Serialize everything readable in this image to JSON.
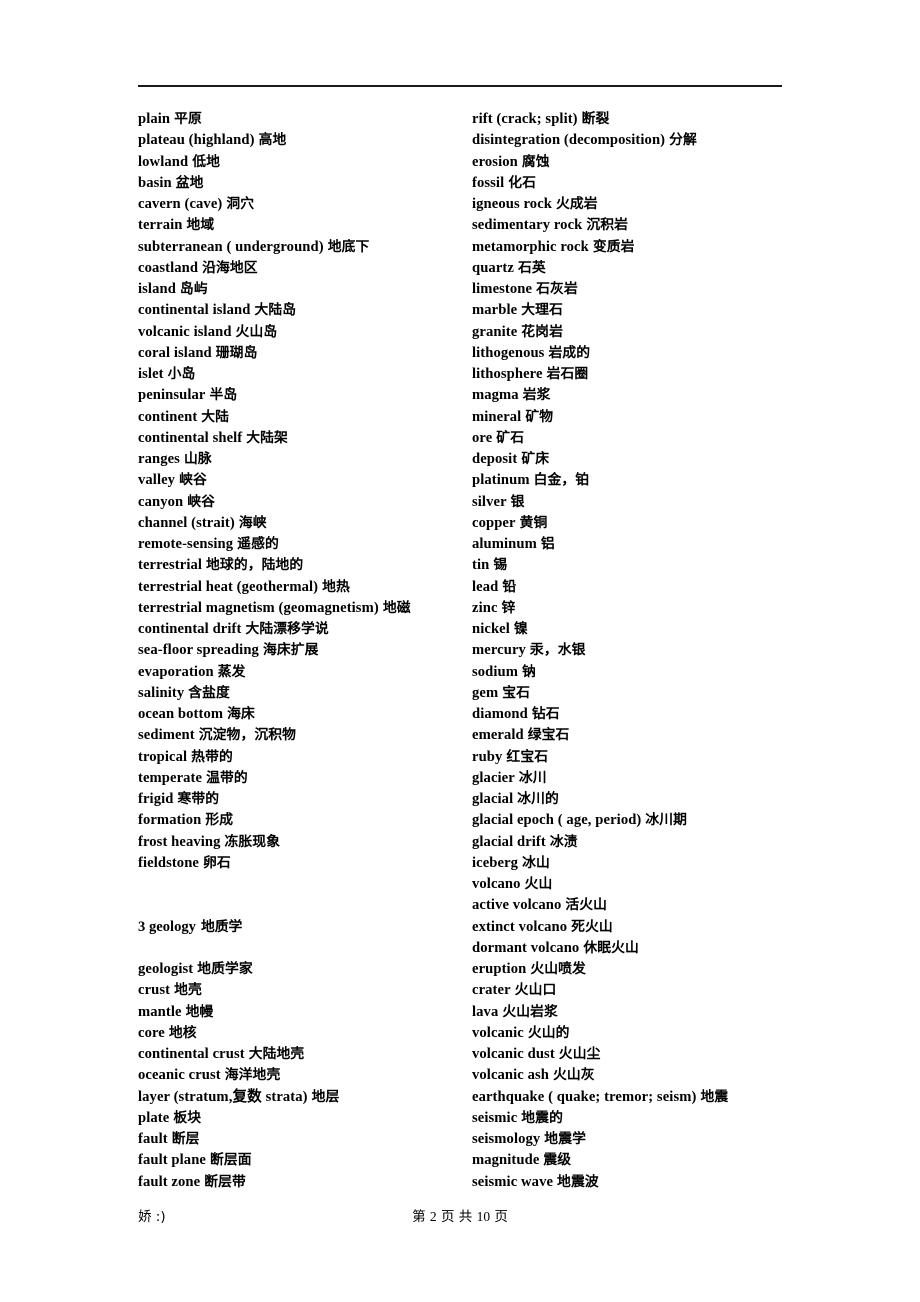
{
  "document": {
    "header_rule": true
  },
  "left_column": {
    "blocks": [
      {
        "type": "list",
        "entries": [
          {
            "term": "plain",
            "gloss": "平原"
          },
          {
            "term": "plateau (highland)",
            "gloss": "高地"
          },
          {
            "term": "lowland",
            "gloss": "低地"
          },
          {
            "term": "basin",
            "gloss": "盆地"
          },
          {
            "term": "cavern (cave)",
            "gloss": "洞穴"
          },
          {
            "term": "terrain",
            "gloss": "地域"
          },
          {
            "term": "subterranean ( underground)",
            "gloss": "地底下"
          },
          {
            "term": "coastland",
            "gloss": "沿海地区"
          },
          {
            "term": "island",
            "gloss": "岛屿"
          },
          {
            "term": "continental island",
            "gloss": "大陆岛"
          },
          {
            "term": "volcanic island",
            "gloss": "火山岛"
          },
          {
            "term": "coral island",
            "gloss": "珊瑚岛"
          },
          {
            "term": "islet",
            "gloss": "小岛"
          },
          {
            "term": "peninsular",
            "gloss": "半岛"
          },
          {
            "term": "continent",
            "gloss": "大陆"
          },
          {
            "term": "continental shelf",
            "gloss": "大陆架"
          },
          {
            "term": "ranges",
            "gloss": "山脉"
          },
          {
            "term": "valley",
            "gloss": "峡谷"
          },
          {
            "term": "canyon",
            "gloss": "峡谷"
          },
          {
            "term": "channel (strait)",
            "gloss": "海峡"
          },
          {
            "term": "remote-sensing",
            "gloss": "遥感的"
          },
          {
            "term": "terrestrial",
            "gloss": "地球的，陆地的"
          },
          {
            "term": "terrestrial heat (geothermal)",
            "gloss": "地热"
          },
          {
            "term": "terrestrial magnetism (geomagnetism)",
            "gloss": "地磁"
          },
          {
            "term": "continental drift",
            "gloss": "大陆漂移学说"
          },
          {
            "term": "sea-floor spreading",
            "gloss": "海床扩展"
          },
          {
            "term": "evaporation",
            "gloss": "蒸发"
          },
          {
            "term": "salinity",
            "gloss": "含盐度"
          },
          {
            "term": "ocean bottom",
            "gloss": "海床"
          },
          {
            "term": "sediment",
            "gloss": "沉淀物，沉积物"
          },
          {
            "term": "tropical",
            "gloss": "热带的"
          },
          {
            "term": "temperate",
            "gloss": "温带的"
          },
          {
            "term": "frigid",
            "gloss": "寒带的"
          },
          {
            "term": "formation",
            "gloss": "形成"
          },
          {
            "term": "frost heaving",
            "gloss": "冻胀现象"
          },
          {
            "term": "fieldstone",
            "gloss": "卵石"
          }
        ]
      },
      {
        "type": "heading",
        "term": "3 geology",
        "gloss": "地质学"
      },
      {
        "type": "list",
        "entries": [
          {
            "term": "geologist",
            "gloss": "地质学家"
          },
          {
            "term": "crust",
            "gloss": "地壳"
          },
          {
            "term": "mantle",
            "gloss": "地幔"
          },
          {
            "term": "core",
            "gloss": "地核"
          },
          {
            "term": "continental crust",
            "gloss": "大陆地壳"
          },
          {
            "term": "oceanic crust",
            "gloss": "海洋地壳"
          },
          {
            "term": "layer (stratum,复数 strata)",
            "gloss": "地层"
          },
          {
            "term": "plate",
            "gloss": "板块"
          },
          {
            "term": "fault",
            "gloss": "断层"
          },
          {
            "term": "fault plane",
            "gloss": "断层面"
          },
          {
            "term": "fault zone",
            "gloss": "断层带"
          }
        ]
      }
    ]
  },
  "right_column": {
    "blocks": [
      {
        "type": "list",
        "entries": [
          {
            "term": "rift (crack; split)",
            "gloss": "断裂"
          },
          {
            "term": "disintegration (decomposition)",
            "gloss": "分解"
          },
          {
            "term": "erosion",
            "gloss": "腐蚀"
          },
          {
            "term": "fossil",
            "gloss": "化石"
          },
          {
            "term": "igneous rock",
            "gloss": "火成岩"
          },
          {
            "term": "sedimentary rock",
            "gloss": "沉积岩"
          },
          {
            "term": "metamorphic rock",
            "gloss": "变质岩"
          },
          {
            "term": "quartz",
            "gloss": "石英"
          },
          {
            "term": "limestone",
            "gloss": "石灰岩"
          },
          {
            "term": "marble",
            "gloss": "大理石"
          },
          {
            "term": "granite",
            "gloss": "花岗岩"
          },
          {
            "term": "lithogenous",
            "gloss": "岩成的"
          },
          {
            "term": "lithosphere",
            "gloss": "岩石圈"
          },
          {
            "term": "magma",
            "gloss": "岩浆"
          },
          {
            "term": "mineral",
            "gloss": "矿物"
          },
          {
            "term": "ore",
            "gloss": "矿石"
          },
          {
            "term": "deposit",
            "gloss": "矿床"
          },
          {
            "term": "platinum",
            "gloss": "白金，铂"
          },
          {
            "term": "silver",
            "gloss": "银"
          },
          {
            "term": "copper",
            "gloss": "黄铜"
          },
          {
            "term": "aluminum",
            "gloss": "铝"
          },
          {
            "term": "tin",
            "gloss": "锡"
          },
          {
            "term": "lead",
            "gloss": "铅"
          },
          {
            "term": "zinc",
            "gloss": "锌"
          },
          {
            "term": "nickel",
            "gloss": "镍"
          },
          {
            "term": "mercury",
            "gloss": "汞，水银"
          },
          {
            "term": "sodium",
            "gloss": "钠"
          },
          {
            "term": "gem",
            "gloss": "宝石"
          },
          {
            "term": "diamond",
            "gloss": "钻石"
          },
          {
            "term": "emerald",
            "gloss": "绿宝石"
          },
          {
            "term": "ruby",
            "gloss": "红宝石"
          },
          {
            "term": "glacier",
            "gloss": "冰川"
          },
          {
            "term": "glacial",
            "gloss": "冰川的"
          },
          {
            "term": "glacial epoch ( age, period)",
            "gloss": "冰川期"
          },
          {
            "term": "glacial drift",
            "gloss": "冰渍"
          },
          {
            "term": "iceberg",
            "gloss": "冰山"
          },
          {
            "term": "volcano",
            "gloss": "火山"
          },
          {
            "term": "active volcano",
            "gloss": "活火山"
          },
          {
            "term": "extinct volcano",
            "gloss": "死火山"
          },
          {
            "term": "dormant volcano",
            "gloss": "休眠火山"
          },
          {
            "term": "eruption",
            "gloss": "火山喷发"
          },
          {
            "term": "crater",
            "gloss": "火山口"
          },
          {
            "term": "lava",
            "gloss": "火山岩浆"
          },
          {
            "term": "volcanic",
            "gloss": "火山的"
          },
          {
            "term": "volcanic dust",
            "gloss": "火山尘"
          },
          {
            "term": "volcanic ash",
            "gloss": "火山灰"
          },
          {
            "term": "earthquake ( quake; tremor; seism)",
            "gloss": "地震"
          },
          {
            "term": "seismic",
            "gloss": "地震的"
          },
          {
            "term": "seismology",
            "gloss": "地震学"
          },
          {
            "term": "magnitude",
            "gloss": "震级"
          },
          {
            "term": "seismic wave",
            "gloss": "地震波"
          }
        ]
      }
    ]
  },
  "footer": {
    "left_note": "娇 :)",
    "page_label_prefix": "第",
    "current_page": "2",
    "page_label_middle": "页 共",
    "total_pages": "10",
    "page_label_suffix": "页"
  }
}
